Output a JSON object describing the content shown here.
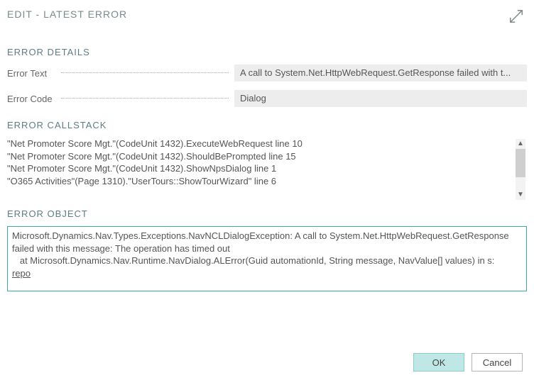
{
  "header": {
    "title": "EDIT - LATEST ERROR"
  },
  "sections": {
    "details_title": "ERROR DETAILS",
    "callstack_title": "ERROR CALLSTACK",
    "object_title": "ERROR OBJECT"
  },
  "fields": {
    "error_text_label": "Error Text",
    "error_text_value": "A call to System.Net.HttpWebRequest.GetResponse failed with t...",
    "error_code_label": "Error Code",
    "error_code_value": "Dialog"
  },
  "callstack": {
    "l0": "\"Net Promoter Score Mgt.\"(CodeUnit 1432).ExecuteWebRequest line 10",
    "l1": "\"Net Promoter Score Mgt.\"(CodeUnit 1432).ShouldBePrompted line 15",
    "l2": "\"Net Promoter Score Mgt.\"(CodeUnit 1432).ShowNpsDialog line 1",
    "l3": "\"O365 Activities\"(Page 1310).\"UserTours::ShowTourWizard\" line 6"
  },
  "error_object": {
    "text": "Microsoft.Dynamics.Nav.Types.Exceptions.NavNCLDialogException: A call to System.Net.HttpWebRequest.GetResponse failed with this message: The operation has timed out\n   at Microsoft.Dynamics.Nav.Runtime.NavDialog.ALError(Guid automationId, String message, NavValue[] values) in s:",
    "last": "repo"
  },
  "buttons": {
    "ok": "OK",
    "cancel": "Cancel"
  },
  "icons": {
    "expand": "expand-icon",
    "scroll_up": "▲",
    "scroll_down": "▼"
  }
}
